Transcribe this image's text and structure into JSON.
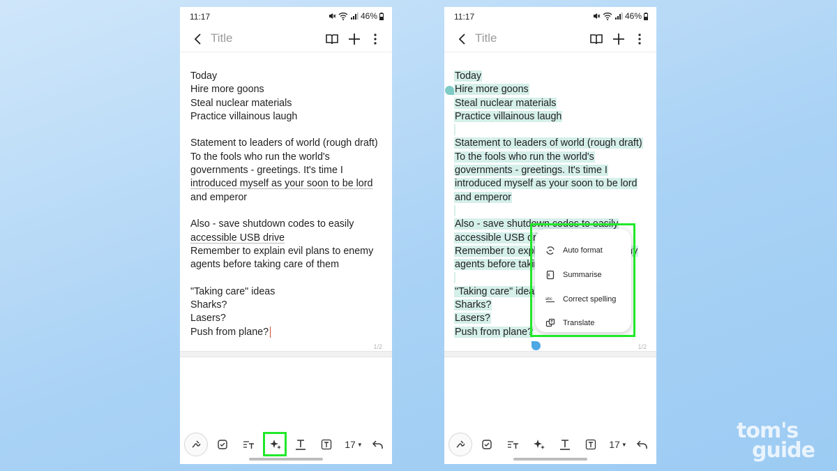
{
  "status": {
    "time": "11:17",
    "battery": "46%"
  },
  "appbar": {
    "title": "Title"
  },
  "note_lines": [
    "Today",
    "Hire more goons",
    "Steal nuclear materials",
    "Practice villainous laugh",
    "",
    "Statement to leaders of world (rough draft)",
    "To the fools who run the world's",
    "governments - greetings. It's time I",
    "introduced myself as your soon to be lord",
    "and emperor",
    "",
    "Also - save shutdown codes to easily",
    "accessible USB drive",
    "Remember to explain evil plans to enemy",
    "agents before taking care of them",
    "",
    "\"Taking care\" ideas",
    "Sharks?",
    "Lasers?",
    "Push from plane?"
  ],
  "page_indicator": "1/2",
  "toolbar": {
    "font_size": "17"
  },
  "ai_menu": [
    {
      "label": "Auto format",
      "icon": "auto-format-icon"
    },
    {
      "label": "Summarise",
      "icon": "summarise-icon"
    },
    {
      "label": "Correct spelling",
      "icon": "correct-spelling-icon"
    },
    {
      "label": "Translate",
      "icon": "translate-icon"
    }
  ],
  "watermark": {
    "line1": "tom's",
    "line2": "guide"
  },
  "colors": {
    "highlight": "#22e82a",
    "selection": "#d5efe9",
    "handle": "#2aa8a0"
  }
}
